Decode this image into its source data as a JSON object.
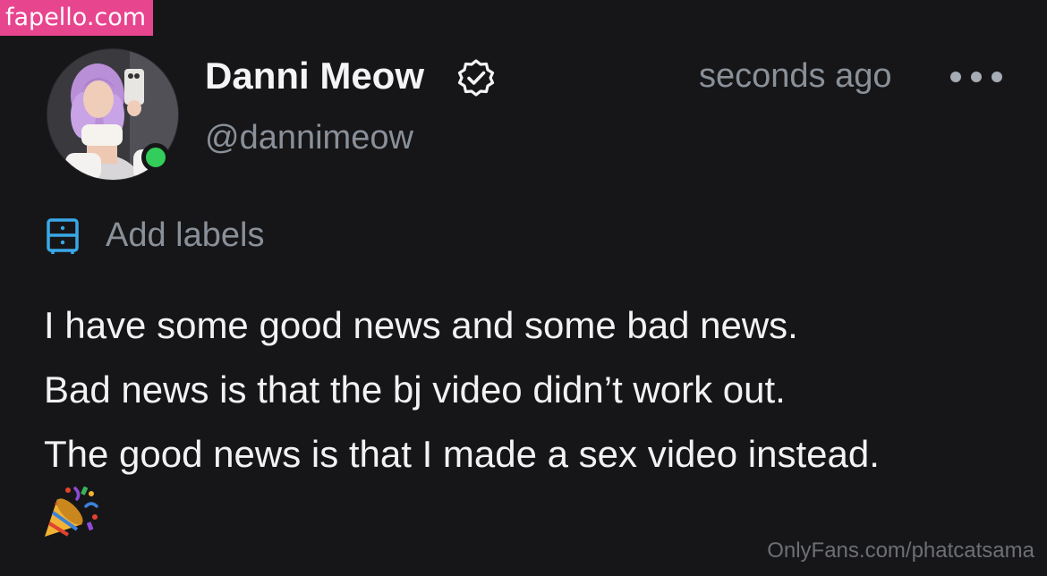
{
  "watermark_top": "fapello.com",
  "post": {
    "author": {
      "display_name": "Danni Meow",
      "handle": "@dannimeow",
      "verified": true,
      "online": true
    },
    "timestamp": "seconds ago",
    "add_labels_text": "Add labels",
    "body_lines": [
      "I have some good news and some bad news.",
      "Bad news is that the bj video didn’t work out.",
      "The good news is that I made a sex video instead."
    ],
    "emoji": "party-popper"
  },
  "watermark_bottom": "OnlyFans.com/phatcatsama",
  "icons": {
    "verified": "verified-badge-icon",
    "more": "more-options-icon",
    "labels": "labels-drawer-icon",
    "party": "party-popper-icon"
  },
  "colors": {
    "background": "#161618",
    "watermark_bg": "#e8458f",
    "muted_text": "#8a9099",
    "online": "#32cd5a",
    "label_icon": "#3aa8e8"
  }
}
